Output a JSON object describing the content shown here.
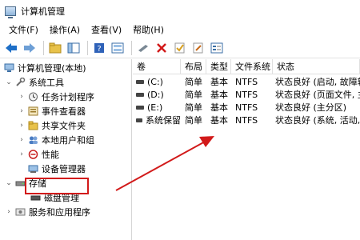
{
  "window": {
    "title": "计算机管理"
  },
  "menu": [
    "文件(F)",
    "操作(A)",
    "查看(V)",
    "帮助(H)"
  ],
  "toolbar": {
    "icons": [
      "back-icon",
      "forward-icon",
      "up-folder-icon",
      "show-hide-tree-icon",
      "help-icon",
      "console-icon",
      "connect-icon",
      "delete-icon",
      "check-icon",
      "edit-icon",
      "properties-icon"
    ]
  },
  "tree": {
    "root": "计算机管理(本地)",
    "system_tools": "系统工具",
    "task_scheduler": "任务计划程序",
    "event_viewer": "事件查看器",
    "shared_folders": "共享文件夹",
    "local_users": "本地用户和组",
    "performance": "性能",
    "device_manager": "设备管理器",
    "storage": "存储",
    "disk_management": "磁盘管理",
    "services_apps": "服务和应用程序"
  },
  "table": {
    "headers": [
      "卷",
      "布局",
      "类型",
      "文件系统",
      "状态"
    ],
    "rows": [
      [
        "(C:)",
        "简单",
        "基本",
        "NTFS",
        "状态良好 (启动, 故障转储"
      ],
      [
        "(D:)",
        "简单",
        "基本",
        "NTFS",
        "状态良好 (页面文件, 主分"
      ],
      [
        "(E:)",
        "简单",
        "基本",
        "NTFS",
        "状态良好 (主分区)"
      ],
      [
        "系统保留",
        "简单",
        "基本",
        "NTFS",
        "状态良好 (系统, 活动, 主分"
      ]
    ]
  },
  "colors": {
    "annotation": "#d21a1a",
    "accent": "#1e6fc7"
  }
}
